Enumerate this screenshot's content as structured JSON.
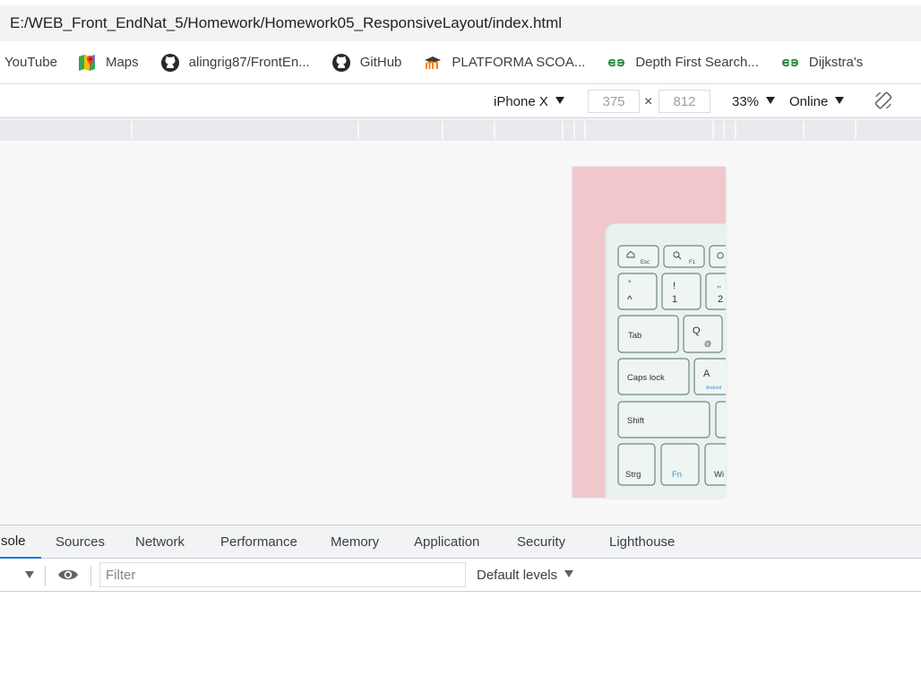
{
  "address": {
    "url": "E:/WEB_Front_EndNat_5/Homework/Homework05_ResponsiveLayout/index.html"
  },
  "bookmarks": [
    {
      "label": "YouTube",
      "icon": "youtube-icon"
    },
    {
      "label": "Maps",
      "icon": "google-maps-icon"
    },
    {
      "label": "alingrig87/FrontEn...",
      "icon": "github-icon"
    },
    {
      "label": "GitHub",
      "icon": "github-icon"
    },
    {
      "label": "PLATFORMA SCOA...",
      "icon": "moodle-icon"
    },
    {
      "label": "Depth First Search...",
      "icon": "geeksforgeeks-icon"
    },
    {
      "label": "Dijkstra's",
      "icon": "geeksforgeeks-icon"
    }
  ],
  "device_toolbar": {
    "device": "iPhone X",
    "width": "375",
    "times": "×",
    "height": "812",
    "zoom": "33%",
    "throttle": "Online",
    "rotate_icon": "rotate-icon"
  },
  "keyboard": {
    "keys": [
      "Esc",
      "F1",
      "Tab",
      "Q",
      "@",
      "Caps lock",
      "A",
      "Android",
      "Shift",
      "Strg",
      "Fn",
      "Wi"
    ],
    "digits": [
      "!",
      "1",
      "2",
      "°",
      "^"
    ],
    "colors": {
      "background": "#f0c8cc",
      "keys": "#e6f0ee",
      "fn_key": "#3a8ed8"
    }
  },
  "devtools_tabs": [
    {
      "label": "sole",
      "active": true
    },
    {
      "label": "Sources",
      "active": false
    },
    {
      "label": "Network",
      "active": false
    },
    {
      "label": "Performance",
      "active": false
    },
    {
      "label": "Memory",
      "active": false
    },
    {
      "label": "Application",
      "active": false
    },
    {
      "label": "Security",
      "active": false
    },
    {
      "label": "Lighthouse",
      "active": false
    }
  ],
  "console_toolbar": {
    "filter_placeholder": "Filter",
    "levels": "Default levels",
    "eye_icon": "eye-icon"
  }
}
